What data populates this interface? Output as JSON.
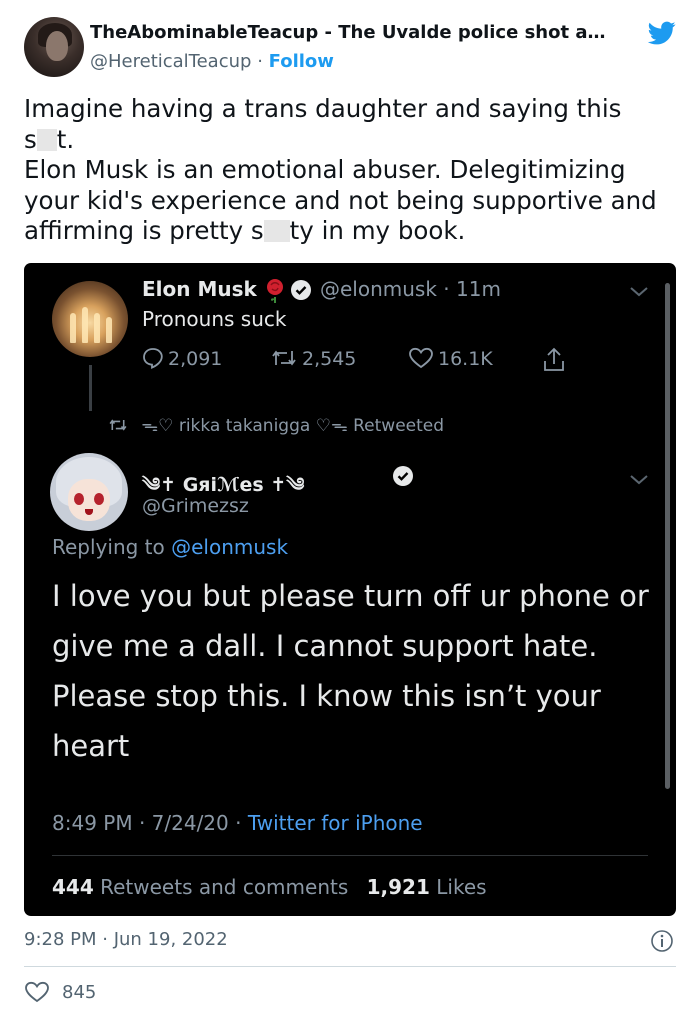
{
  "header": {
    "display_name": "TheAbominableTeacup - The Uvalde police shot a…",
    "handle": "@HereticalTeacup",
    "separator": "·",
    "follow_label": "Follow",
    "brand_icon": "twitter-bird-icon",
    "brand_color": "#1d9bf0"
  },
  "tweet": {
    "line1": "Imagine having a trans daughter and saying this",
    "line2_a": "s",
    "line2_b": "t.",
    "line3": "Elon Musk is an emotional abuser. Delegitimizing your kid's experience and not being supportive and affirming is pretty s",
    "line3_end": "ty in my book."
  },
  "embedded": {
    "elon": {
      "name": "Elon Musk",
      "handle_time": "@elonmusk · 11m",
      "text": "Pronouns suck",
      "replies": "2,091",
      "retweets": "2,545",
      "likes": "16.1K"
    },
    "retweet_notice": "rikka takanigga",
    "retweet_suffix": "Retweeted",
    "grimes": {
      "name": "Gяiℳes",
      "handle": "@Grimezsz",
      "replying_prefix": "Replying to",
      "replying_to": "@elonmusk",
      "text": "I love you but please turn off ur phone or give me a dall.  I cannot support hate. Please stop this. I know this isn’t your heart",
      "time_date": "8:49 PM · 7/24/20 ·",
      "client": "Twitter for iPhone",
      "retweets_count": "444",
      "retweets_label": "Retweets and comments",
      "likes_count": "1,921",
      "likes_label": "Likes"
    }
  },
  "footer": {
    "timestamp": "9:28 PM · Jun 19, 2022",
    "likes": "845"
  },
  "colors": {
    "dark_bg": "#000000",
    "link_blue": "#4d9ff0",
    "muted_gray": "#8b98a5",
    "heart_red": "#c0152a"
  }
}
